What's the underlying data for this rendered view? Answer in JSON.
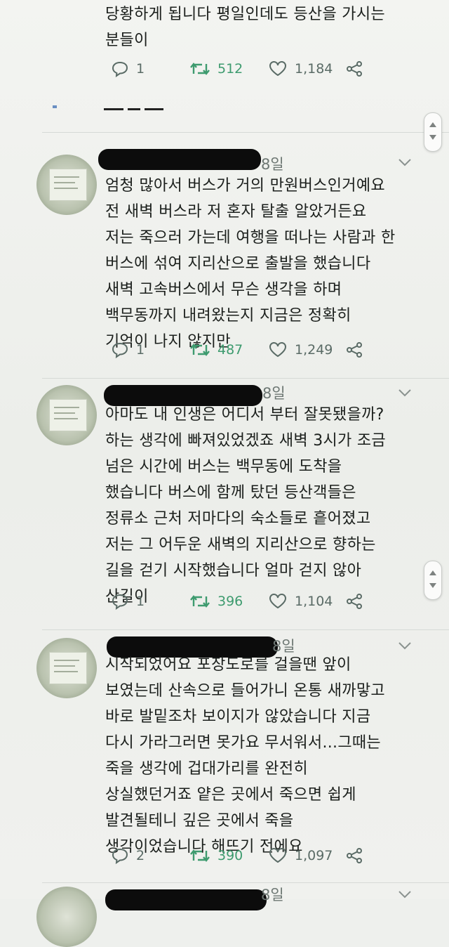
{
  "tweets": [
    {
      "text": "당황하게 됩니다 평일인데도 등산을 가시는\n분들이",
      "replies": "1",
      "retweets": "512",
      "likes": "1,184"
    },
    {
      "date": "8일",
      "text": "엄청 많아서 버스가 거의 만원버스인거예요\n전 새벽 버스라 저 혼자 탈출 알았거든요\n저는 죽으러 가는데 여행을 떠나는 사람과 한\n버스에 섞여 지리산으로 출발을 했습니다\n새벽 고속버스에서 무슨 생각을 하며\n백무동까지 내려왔는지 지금은 정확히\n기억이 나지 않지만",
      "replies": "1",
      "retweets": "487",
      "likes": "1,249"
    },
    {
      "date": "8일",
      "text": "아마도 내 인생은 어디서 부터 잘못됐을까?\n하는 생각에 빠져있었겠죠 새벽 3시가 조금\n넘은 시간에 버스는 백무동에 도착을\n했습니다 버스에 함께 탔던 등산객들은\n정류소 근처 저마다의 숙소들로 흩어졌고\n저는 그 어두운 새벽의 지리산으로 향하는\n길을 걷기 시작했습니다 얼마 걷지 않아\n산길이",
      "replies": "1",
      "retweets": "396",
      "likes": "1,104"
    },
    {
      "date": "8일",
      "text": "시작되었어요 포장도로를 걸을땐 앞이\n보였는데 산속으로 들어가니 온통 새까맣고\n바로 발밑조차 보이지가 않았습니다 지금\n다시 가라그러면 못가요 무서워서...그때는\n죽을 생각에 겁대가리를 완전히\n상실했던거죠 얕은 곳에서 죽으면 쉽게\n발견될테니 깊은 곳에서 죽을\n생각이었습니다 해뜨기 전에요",
      "replies": "2",
      "retweets": "390",
      "likes": "1,097"
    },
    {
      "date": "8일"
    }
  ],
  "icons": {
    "reply": "reply-icon",
    "retweet": "retweet-icon",
    "like": "heart-icon",
    "share": "share-icon",
    "more": "chevron-down-icon"
  },
  "colors": {
    "retweet": "#3e9b6f",
    "action": "#5a6b66",
    "text": "#1b1f1c"
  }
}
